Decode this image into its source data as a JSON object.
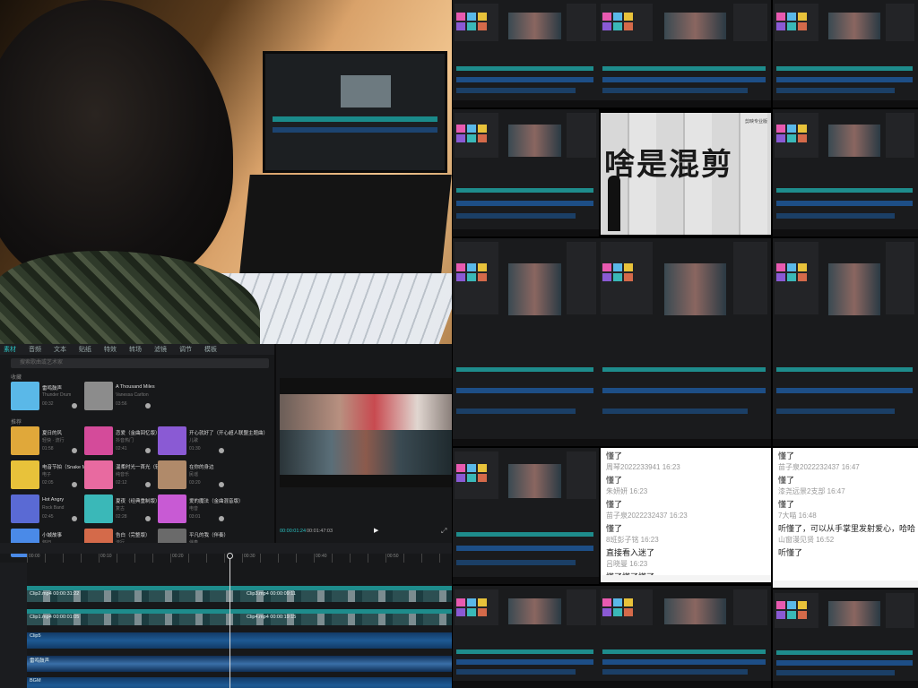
{
  "editor": {
    "menu": [
      "素材",
      "音频",
      "文本",
      "贴纸",
      "特效",
      "转场",
      "滤镜",
      "调节",
      "模板"
    ],
    "search_placeholder": "搜索歌曲或艺术家",
    "section_recent": "收藏",
    "section_recommend": "推荐",
    "recent": [
      {
        "title": "雷鸣鼓声",
        "sub": "Thunder Drum",
        "dur": "00:32",
        "color": "#5ab8e8"
      },
      {
        "title": "A Thousand Miles",
        "sub": "Vanessa Carlton",
        "dur": "03:56",
        "color": "#8c8c8c"
      }
    ],
    "recommend": [
      {
        "title": "夏日的风",
        "sub": "轻快 · 流行",
        "dur": "01:58",
        "color": "#e0a83a"
      },
      {
        "title": "恋爱（金曲回忆版）",
        "sub": "抖音热门",
        "dur": "02:41",
        "color": "#d44b9a"
      },
      {
        "title": "开心就好了（开心超人联盟主题曲）",
        "sub": "儿歌",
        "dur": "01:30",
        "color": "#8a5ad4"
      },
      {
        "title": "电音节拍（Snake Mix）",
        "sub": "电子",
        "dur": "02:05",
        "color": "#e8c23a"
      },
      {
        "title": "温柔时光一首光（轻音乐）",
        "sub": "纯音乐",
        "dur": "02:12",
        "color": "#e86aa0"
      },
      {
        "title": "在你的身边",
        "sub": "民谣",
        "dur": "03:20",
        "color": "#b08a6a"
      },
      {
        "title": "Hot Angry",
        "sub": "Rock Band",
        "dur": "02:45",
        "color": "#5a6ad4"
      },
      {
        "title": "夏夜（经典重制版）",
        "sub": "复古",
        "dur": "02:28",
        "color": "#3ab8b8"
      },
      {
        "title": "爱的魔法（金曲混音版）",
        "sub": "电音",
        "dur": "03:01",
        "color": "#c85ad4"
      },
      {
        "title": "小城故事",
        "sub": "怀旧",
        "dur": "02:50",
        "color": "#4a8ae8"
      },
      {
        "title": "告白（完整版）",
        "sub": "流行",
        "dur": "03:33",
        "color": "#d46a4a"
      },
      {
        "title": "平凡的我（伴奏）",
        "sub": "伴奏",
        "dur": "04:02",
        "color": "#6a6a6a"
      }
    ],
    "preview_time": "00:00:01:24",
    "preview_total": "00:01:47:03",
    "ruler": [
      "00:00",
      "00:10",
      "00:20",
      "00:30",
      "00:40",
      "00:50"
    ],
    "tracks": [
      {
        "label": "Clip2.mp4  00:00:31:22",
        "label2": "Clip3.mp4  00:00:09:11",
        "kind": "video"
      },
      {
        "label": "Clip1.mp4  00:00:01:05",
        "label2": "Clip4.mp4  00:00:19:15",
        "kind": "video"
      },
      {
        "label": "Clip5",
        "kind": "audio"
      },
      {
        "label": "雷鸣鼓声",
        "kind": "audio"
      },
      {
        "label": "BGM",
        "kind": "audio"
      }
    ]
  },
  "title_card": {
    "text": "啥是混剪",
    "badge": "剪映专业版"
  },
  "chat_left": [
    {
      "type": "msg",
      "text": "懂了"
    },
    {
      "type": "name",
      "text": "周琴2022233941 16:23"
    },
    {
      "type": "msg",
      "text": "懂了"
    },
    {
      "type": "name",
      "text": "朱妍妍 16:23"
    },
    {
      "type": "msg",
      "text": "懂了"
    },
    {
      "type": "name",
      "text": "苗子泉2022232437 16:23"
    },
    {
      "type": "msg",
      "text": "懂了"
    },
    {
      "type": "name",
      "text": "8班彭子铭 16:23"
    },
    {
      "type": "msg",
      "text": "直接看入迷了"
    },
    {
      "type": "name",
      "text": "吕晓曼 16:23"
    },
    {
      "type": "msg",
      "text": "懂了懂了懂了"
    }
  ],
  "chat_right": [
    {
      "type": "msg",
      "text": "懂了"
    },
    {
      "type": "name",
      "text": "苗子泉2022232437 16:47"
    },
    {
      "type": "msg",
      "text": "懂了"
    },
    {
      "type": "name",
      "text": "漆尧远景2支部 16:47"
    },
    {
      "type": "msg",
      "text": "懂了"
    },
    {
      "type": "name",
      "text": "7大喵 16:48"
    },
    {
      "type": "msg",
      "text": "听懂了，可以从手掌里发射爱心，哈哈"
    },
    {
      "type": "name",
      "text": "山窗漫见贤 16:52"
    },
    {
      "type": "msg",
      "text": "听懂了"
    }
  ]
}
